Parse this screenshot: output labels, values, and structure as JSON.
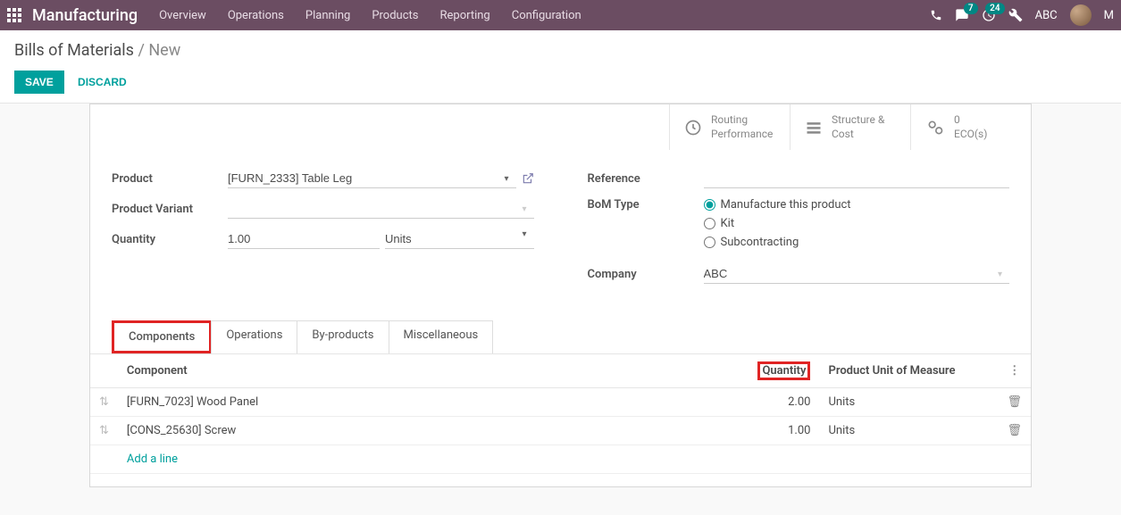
{
  "nav": {
    "app_title": "Manufacturing",
    "menu": [
      "Overview",
      "Operations",
      "Planning",
      "Products",
      "Reporting",
      "Configuration"
    ],
    "chat_badge": "7",
    "activity_badge": "24",
    "company": "ABC"
  },
  "breadcrumb": {
    "parent": "Bills of Materials",
    "current": "New"
  },
  "buttons": {
    "save": "SAVE",
    "discard": "DISCARD"
  },
  "stats": [
    {
      "line1": "Routing",
      "line2": "Performance"
    },
    {
      "line1": "Structure &",
      "line2": "Cost"
    },
    {
      "line1": "0",
      "line2": "ECO(s)"
    }
  ],
  "form": {
    "product_label": "Product",
    "product_value": "[FURN_2333] Table Leg",
    "variant_label": "Product Variant",
    "variant_value": "",
    "qty_label": "Quantity",
    "qty_value": "1.00",
    "uom_value": "Units",
    "ref_label": "Reference",
    "ref_value": "",
    "bom_type_label": "BoM Type",
    "bom_types": [
      "Manufacture this product",
      "Kit",
      "Subcontracting"
    ],
    "company_label": "Company",
    "company_value": "ABC"
  },
  "tabs": [
    "Components",
    "Operations",
    "By-products",
    "Miscellaneous"
  ],
  "table": {
    "headers": {
      "component": "Component",
      "qty": "Quantity",
      "uom": "Product Unit of Measure"
    },
    "rows": [
      {
        "component": "[FURN_7023] Wood Panel",
        "qty": "2.00",
        "uom": "Units"
      },
      {
        "component": "[CONS_25630] Screw",
        "qty": "1.00",
        "uom": "Units"
      }
    ],
    "add": "Add a line"
  }
}
